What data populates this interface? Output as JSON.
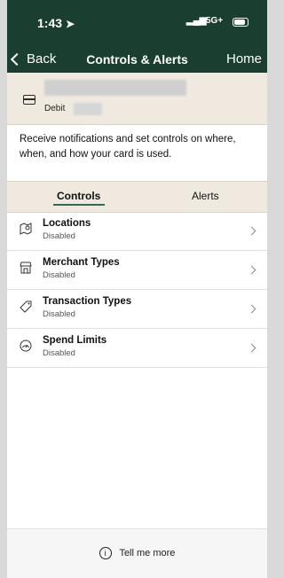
{
  "status_bar": {
    "time": "1:43",
    "network": "5G+"
  },
  "nav": {
    "back_label": "Back",
    "title": "Controls & Alerts",
    "home_label": "Home"
  },
  "card": {
    "type_label": "Debit"
  },
  "description": "Receive notifications and set controls on where, when, and how your card is used.",
  "tabs": [
    {
      "label": "Controls",
      "selected": true
    },
    {
      "label": "Alerts",
      "selected": false
    }
  ],
  "controls": [
    {
      "label": "Locations",
      "status": "Disabled",
      "icon": "map-pin-icon"
    },
    {
      "label": "Merchant Types",
      "status": "Disabled",
      "icon": "store-icon"
    },
    {
      "label": "Transaction Types",
      "status": "Disabled",
      "icon": "tag-icon"
    },
    {
      "label": "Spend Limits",
      "status": "Disabled",
      "icon": "gauge-icon"
    }
  ],
  "footer": {
    "tell_me_more": "Tell me more"
  }
}
